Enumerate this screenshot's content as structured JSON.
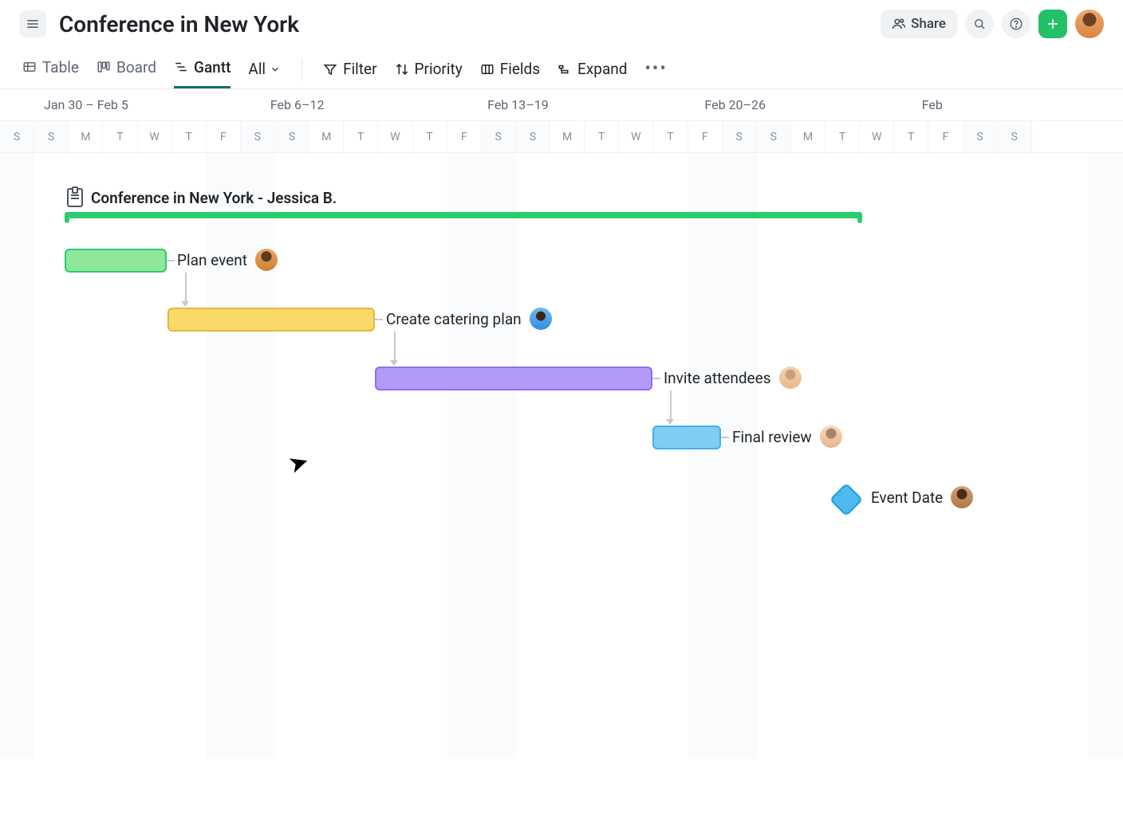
{
  "header": {
    "title": "Conference in New York",
    "share_label": "Share"
  },
  "tabs": {
    "table": "Table",
    "board": "Board",
    "gantt": "Gantt",
    "all": "All"
  },
  "toolbar": {
    "filter": "Filter",
    "priority": "Priority",
    "fields": "Fields",
    "expand": "Expand"
  },
  "week_headers": [
    "Jan 30 – Feb 5",
    "Feb 6–12",
    "Feb 13–19",
    "Feb 20–26",
    "Feb"
  ],
  "day_letters": [
    "S",
    "S",
    "M",
    "T",
    "W",
    "T",
    "F",
    "S",
    "S",
    "M",
    "T",
    "W",
    "T",
    "F",
    "S",
    "S",
    "M",
    "T",
    "W",
    "T",
    "F",
    "S",
    "S",
    "M",
    "T",
    "W",
    "T",
    "F",
    "S",
    "S"
  ],
  "project": {
    "title": "Conference in New York - Jessica B."
  },
  "tasks": {
    "t1": "Plan event",
    "t2": "Create catering plan",
    "t3": "Invite attendees",
    "t4": "Final review",
    "milestone": "Event Date"
  },
  "colors": {
    "accent_green": "#2dcb70",
    "task_green": "#8fe79b",
    "task_yellow": "#f7d154",
    "task_purple": "#a88cf3",
    "task_blue": "#6fc4f1"
  }
}
